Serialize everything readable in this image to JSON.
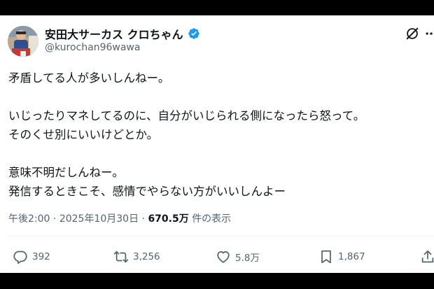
{
  "author": {
    "display_name": "安田大サーカス クロちゃん",
    "handle": "@kurochan96wawa",
    "verified_badge": "verified-badge-icon",
    "avatar": "avatar-photo"
  },
  "tweet": {
    "lines": [
      "矛盾してる人が多いしんねー。",
      "",
      "いじったりマネしてるのに、自分がいじられる側になったら怒って。",
      "そのくせ別にいいけどとか。",
      "",
      "意味不明だしんねー。",
      "発信するときこそ、感情でやらない方がいいしんよー"
    ]
  },
  "meta": {
    "time": "午後2:00",
    "separator": "·",
    "date": "2025年10月30日",
    "views": "670.5万",
    "views_label": "件の表示"
  },
  "actions": {
    "reply_count": "392",
    "retweet_count": "3,256",
    "like_count": "5.8万",
    "bookmark_count": "1,867"
  },
  "colors": {
    "accent": "#1d9bf0",
    "text": "#0f1419",
    "muted": "#536471",
    "background": "#ffffff"
  }
}
